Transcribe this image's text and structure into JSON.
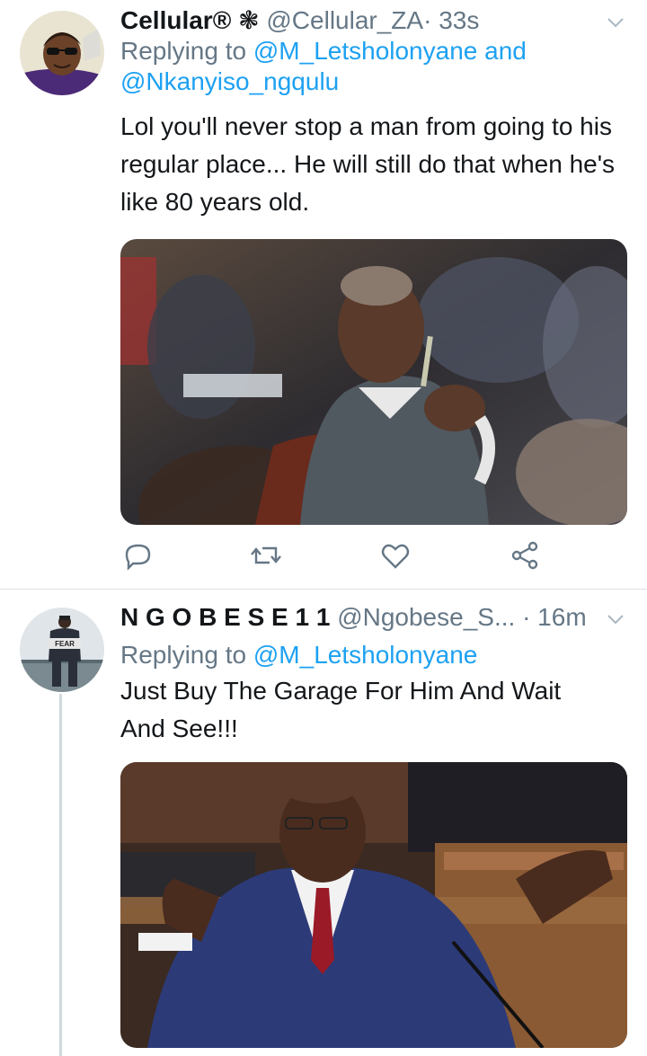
{
  "tweet1": {
    "display_name": "Cellular®",
    "name_emoji": "❃",
    "handle": "@Cellular_ZA",
    "separator": "·",
    "time": "33s",
    "replying_prefix": "Replying to ",
    "mention_1": "@M_Letsholonyane",
    "and_word": " and",
    "mention_2": "@Nkanyiso_ngqulu",
    "text": "Lol you'll never stop a man from going to his regular place... He will still do that when he's like 80 years old.",
    "image_icon": "photo-elderly-man-pointing-in-chair"
  },
  "tweet2": {
    "display_name": "N G O B E S E 1 1",
    "handle": "@Ngobese_S...",
    "separator": "·",
    "time": "16m",
    "replying_prefix": "Replying to ",
    "mention_1": "@M_Letsholonyane",
    "text": "Just Buy The Garage For Him And Wait And See!!!",
    "avatar_shirt_text": "FEAR",
    "image_icon": "photo-man-speaking-at-parliament"
  },
  "actions": [
    "reply-icon",
    "retweet-icon",
    "like-icon",
    "share-icon"
  ],
  "colors": {
    "accent": "#1da1f2",
    "secondary_text": "#657786",
    "primary_text": "#14171a"
  }
}
